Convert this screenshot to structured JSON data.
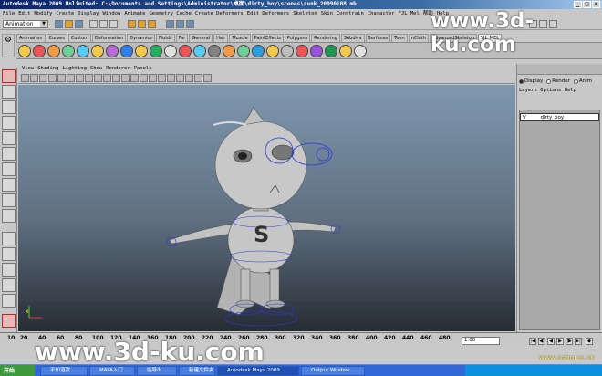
{
  "window": {
    "title": "Autodesk Maya 2009 Unlimited: C:\\Documents and Settings\\Administrator\\桌面\\dirty_boy\\scenes\\sunk_20090108.mb"
  },
  "menubar": [
    "File",
    "Edit",
    "Modify",
    "Create",
    "Display",
    "Window",
    "Animate",
    "Geometry Cache",
    "Create Deformers",
    "Edit Deformers",
    "Skeleton",
    "Skin",
    "Constrain",
    "Character",
    "YJL Mel",
    "帮助",
    "Help"
  ],
  "statusline": {
    "mode": "Animation"
  },
  "shelf": {
    "tabs": [
      "Animation",
      "Curves",
      "Custom",
      "Deformation",
      "Dynamics",
      "Fluids",
      "Fur",
      "General",
      "Hair",
      "Muscle",
      "PaintEffects",
      "Polygons",
      "Rendering",
      "Subdivs",
      "Surfaces",
      "Toon",
      "nCloth",
      "advancedSkeleton",
      "YJL_MEL"
    ],
    "active_tab": "YJL_MEL"
  },
  "panel": {
    "menu": [
      "View",
      "Shading",
      "Lighting",
      "Show",
      "Renderer",
      "Panels"
    ]
  },
  "viewport": {
    "axis_label": "x",
    "character_logo": "S"
  },
  "right_panel": {
    "radios": [
      {
        "label": "Display",
        "selected": true
      },
      {
        "label": "Render",
        "selected": false
      },
      {
        "label": "Anim",
        "selected": false
      }
    ],
    "menu": [
      "Layers",
      "Options",
      "Help"
    ],
    "layer": {
      "visibility": "V",
      "name": "dirty_boy"
    }
  },
  "timeslider": {
    "ticks": [
      "10",
      "20",
      "40",
      "60",
      "80",
      "100",
      "120",
      "140",
      "160",
      "180",
      "200",
      "220",
      "240",
      "260",
      "280",
      "300",
      "320",
      "340",
      "360",
      "380",
      "400",
      "420",
      "440",
      "460",
      "480"
    ],
    "current_frame": "1.00"
  },
  "taskbar": {
    "start": "开始",
    "buttons": [
      "不知道我",
      "MAYA入门",
      "能导出",
      "新建文件夹",
      "Autodesk Maya 2009",
      "Output Window"
    ]
  },
  "watermarks": {
    "top": "www.3d-ku.com",
    "bottom": "www.3d-ku.com",
    "corner": "WWW.CGMODEL.CN"
  },
  "colors": {
    "title_bar": "#0a246a",
    "viewport_top": "#7f98b0",
    "viewport_bottom": "#262c34",
    "taskbar": "#3168d5",
    "selection_red": "#cc2222"
  }
}
